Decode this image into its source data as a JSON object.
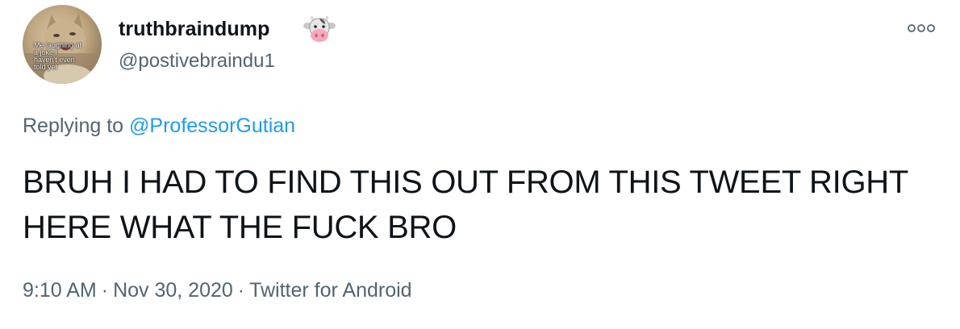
{
  "author": {
    "display_name": "truthbraindump",
    "handle": "@postivebraindu1",
    "name_emoji": "cow-face-icon",
    "avatar_caption": "Me laughing at a joke I haven't even told yet"
  },
  "reply": {
    "prefix": "Replying to",
    "mention": "@ProfessorGutian"
  },
  "tweet": {
    "text": "BRUH I HAD TO FIND THIS OUT FROM THIS TWEET RIGHT HERE WHAT THE FUCK BRO"
  },
  "meta": {
    "time": "9:10 AM",
    "separator": "·",
    "date": "Nov 30, 2020",
    "source": "Twitter for Android"
  },
  "icons": {
    "more": "more-options-icon"
  },
  "colors": {
    "text": "#0f1419",
    "secondary": "#536471",
    "link": "#1d9bf0"
  }
}
